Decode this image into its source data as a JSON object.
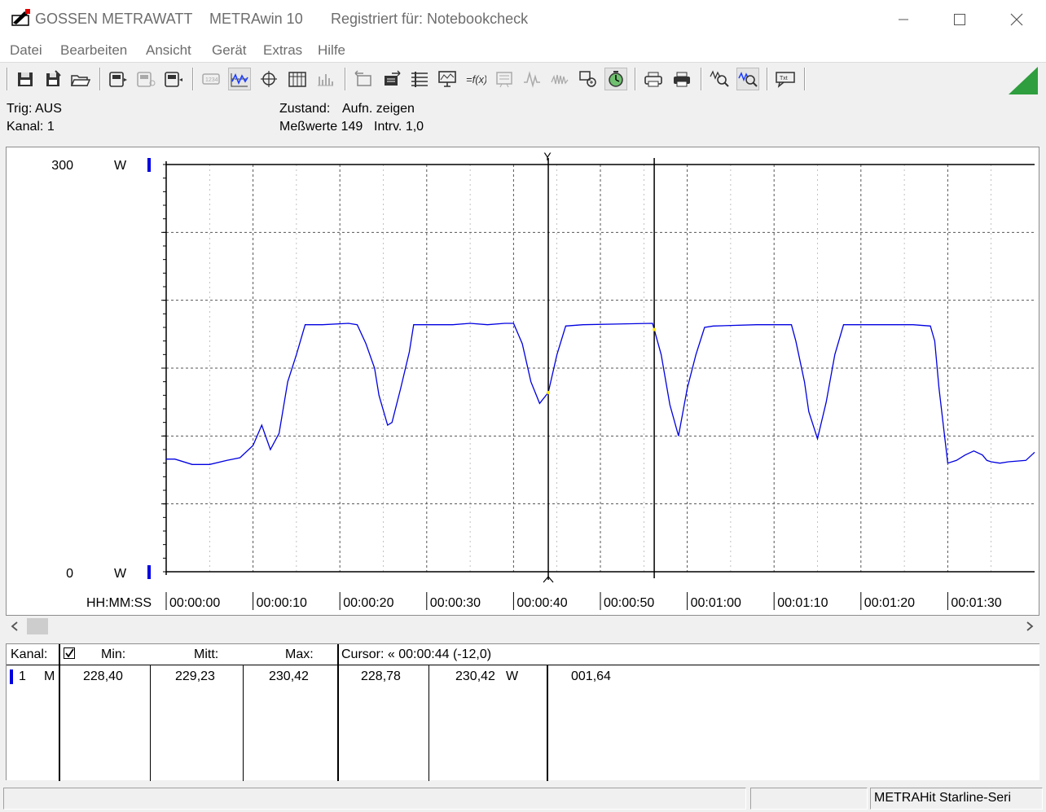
{
  "window": {
    "brand": "GOSSEN METRAWATT",
    "app": "METRAwin 10",
    "registered": "Registriert für: Notebookcheck"
  },
  "menu": [
    "Datei",
    "Bearbeiten",
    "Ansicht",
    "Gerät",
    "Extras",
    "Hilfe"
  ],
  "toolbar_icons": [
    "save-icon",
    "save-as-icon",
    "open-folder-icon",
    "device-read-icon",
    "device-config-icon",
    "device-send-icon",
    "values-icon",
    "curve-view-icon",
    "crosshair-icon",
    "table-view-icon",
    "bar-view-icon",
    "zoom-prev-icon",
    "zoom-next-icon",
    "list-settings-icon",
    "monitor-icon",
    "formula-icon",
    "statistics-icon",
    "signal-icon",
    "signal-2-icon",
    "transfer-icon",
    "timer-icon",
    "print-preview-icon",
    "print-icon",
    "zoom-icon",
    "zoom-area-icon",
    "comment-icon"
  ],
  "status": {
    "trig": "Trig: AUS",
    "kanal": "Kanal: 1",
    "zustand_label": "Zustand:",
    "zustand_value": "Aufn. zeigen",
    "messwerte_label": "Meßwerte 149",
    "intervall": "Intrv. 1,0"
  },
  "chart_data": {
    "type": "line",
    "y_top_label": "300",
    "y_bottom_label": "0",
    "y_unit": "W",
    "ylim": [
      0,
      300
    ],
    "x_axis_label": "HH:MM:SS",
    "x_ticks": [
      "00:00:00",
      "00:00:10",
      "00:00:20",
      "00:00:30",
      "00:00:40",
      "00:00:50",
      "00:01:00",
      "00:01:10",
      "00:01:20",
      "00:01:30"
    ],
    "xlim": [
      0,
      100
    ],
    "grid": true,
    "cursor_left_label": "Y",
    "cursor_left_x": 44,
    "cursor_right_x": 56.2,
    "series": [
      {
        "color": "#0000e0",
        "points": [
          [
            0,
            83
          ],
          [
            1,
            83
          ],
          [
            3,
            79
          ],
          [
            5,
            79
          ],
          [
            7,
            82
          ],
          [
            8.5,
            84
          ],
          [
            10,
            93
          ],
          [
            11,
            108
          ],
          [
            12,
            90
          ],
          [
            13,
            102
          ],
          [
            14,
            140
          ],
          [
            15,
            160
          ],
          [
            16,
            182
          ],
          [
            18,
            182
          ],
          [
            21,
            183
          ],
          [
            22,
            182
          ],
          [
            23,
            168
          ],
          [
            24,
            150
          ],
          [
            24.5,
            130
          ],
          [
            25.5,
            108
          ],
          [
            26,
            110
          ],
          [
            27,
            135
          ],
          [
            28,
            162
          ],
          [
            28.5,
            182
          ],
          [
            30,
            182
          ],
          [
            33,
            182
          ],
          [
            35,
            183
          ],
          [
            37,
            182
          ],
          [
            39,
            183
          ],
          [
            40,
            183
          ],
          [
            41,
            168
          ],
          [
            42,
            140
          ],
          [
            43,
            124
          ],
          [
            44,
            132
          ],
          [
            45,
            160
          ],
          [
            46,
            181
          ],
          [
            48,
            182
          ],
          [
            56,
            183
          ],
          [
            57,
            160
          ],
          [
            58,
            123
          ],
          [
            59,
            100
          ],
          [
            60,
            135
          ],
          [
            61,
            160
          ],
          [
            62,
            180
          ],
          [
            63,
            181
          ],
          [
            68,
            182
          ],
          [
            72,
            182
          ],
          [
            72.5,
            170
          ],
          [
            73.5,
            140
          ],
          [
            74,
            118
          ],
          [
            75,
            98
          ],
          [
            76,
            125
          ],
          [
            77,
            160
          ],
          [
            78,
            182
          ],
          [
            80,
            182
          ],
          [
            84,
            182
          ],
          [
            86,
            182
          ],
          [
            88,
            181
          ],
          [
            88.5,
            170
          ],
          [
            89,
            135
          ],
          [
            90,
            80
          ],
          [
            91,
            82
          ],
          [
            92,
            86
          ],
          [
            93,
            89
          ],
          [
            94,
            86
          ],
          [
            94.5,
            82
          ],
          [
            95,
            81
          ],
          [
            96,
            80
          ],
          [
            97,
            81
          ],
          [
            99,
            82
          ],
          [
            100,
            88
          ]
        ]
      }
    ]
  },
  "table": {
    "headers": {
      "kanal": "Kanal:",
      "min": "Min:",
      "mitt": "Mitt:",
      "max": "Max:",
      "cursor": "Cursor: « 00:00:44 (-12,0)"
    },
    "row": {
      "channel": "1",
      "mode": "M",
      "min": "228,40",
      "mitt": "229,23",
      "max": "230,42",
      "cursor1": "228,78",
      "cursor2": "230,42",
      "unit": "W",
      "diff": "001,64"
    }
  },
  "statusbar": {
    "device": "METRAHit Starline-Seri"
  }
}
